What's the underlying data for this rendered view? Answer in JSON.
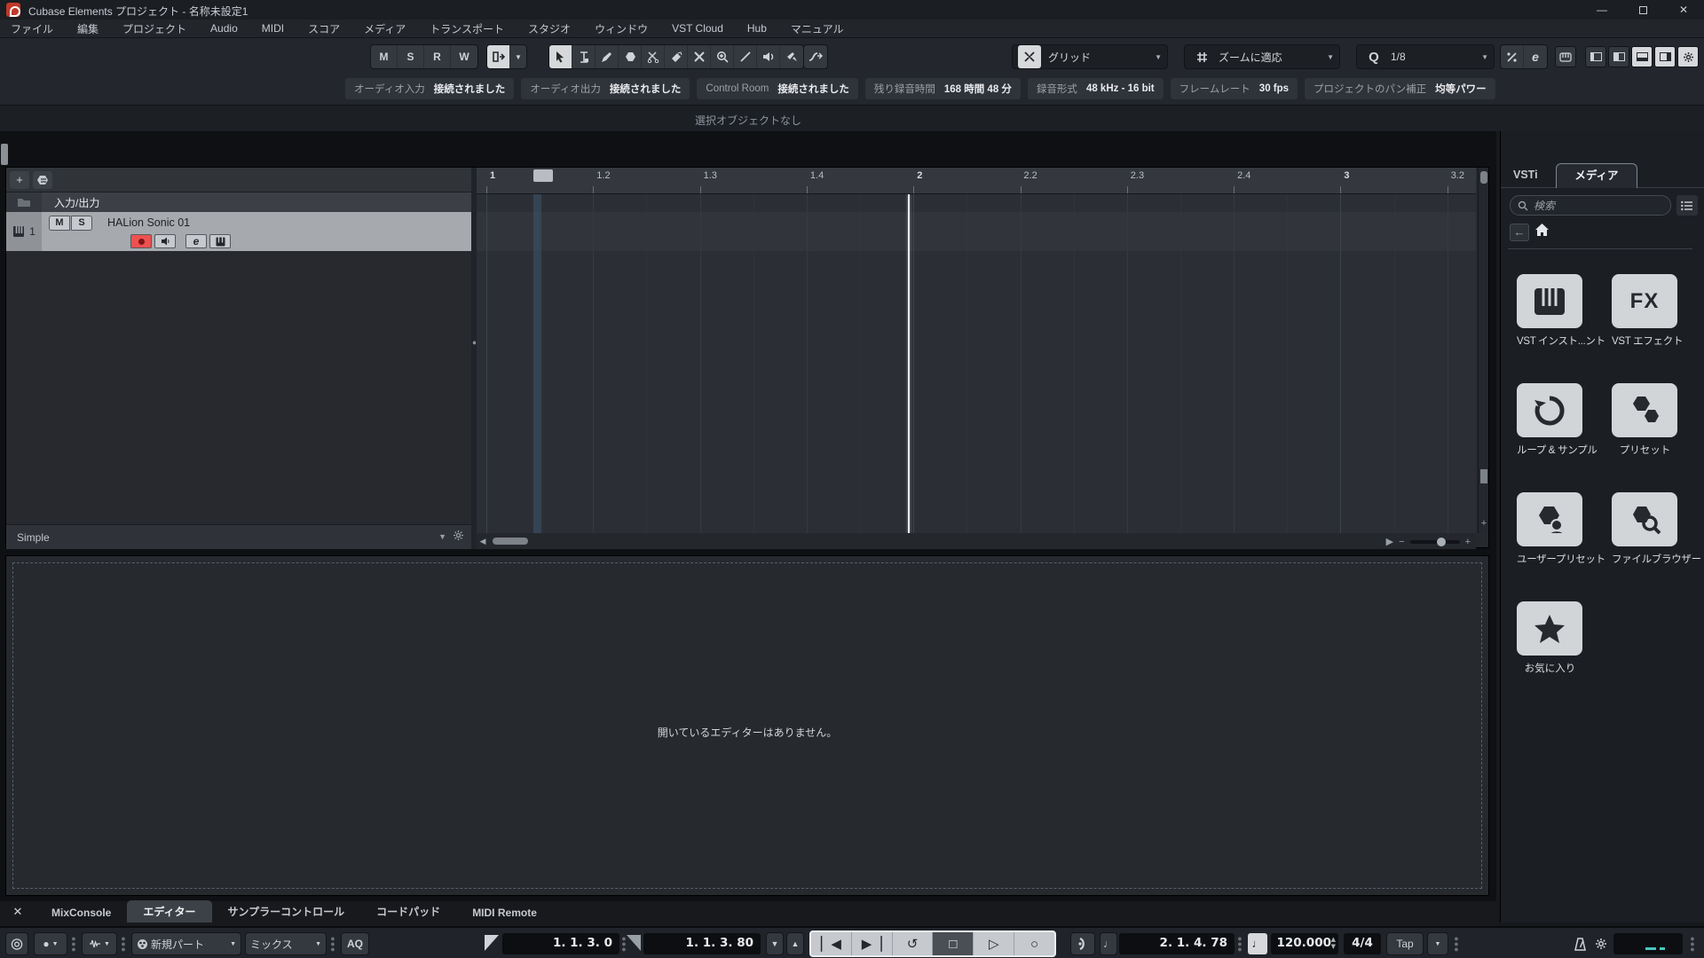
{
  "window": {
    "title": "Cubase Elements プロジェクト - 名称未設定1",
    "minimize": "—",
    "maximize": "",
    "close": "✕"
  },
  "menu": {
    "items": [
      "ファイル",
      "編集",
      "プロジェクト",
      "Audio",
      "MIDI",
      "スコア",
      "メディア",
      "トランスポート",
      "スタジオ",
      "ウィンドウ",
      "VST Cloud",
      "Hub",
      "マニュアル"
    ]
  },
  "toolbar": {
    "automation_buttons": [
      "M",
      "S",
      "R",
      "W"
    ],
    "grid_dropdown": "グリッド",
    "zoom_dropdown": "ズームに適応",
    "quantize_label": "Q",
    "quantize_value": "1/8",
    "quantize_e": "e"
  },
  "status_chips": [
    {
      "label": "オーディオ入力",
      "value": "接続されました"
    },
    {
      "label": "オーディオ出力",
      "value": "接続されました"
    },
    {
      "label": "Control Room",
      "value": "接続されました"
    },
    {
      "label": "残り録音時間",
      "value": "168 時間 48 分"
    },
    {
      "label": "録音形式",
      "value": "48 kHz - 16 bit"
    },
    {
      "label": "フレームレート",
      "value": "30 fps"
    },
    {
      "label": "プロジェクトのパン補正",
      "value": "均等パワー"
    }
  ],
  "info_line": {
    "selection": "選択オブジェクトなし"
  },
  "track_area": {
    "folder_label": "入力/出力",
    "track": {
      "number": "1",
      "name": "HALion Sonic 01",
      "mute": "M",
      "solo": "S",
      "edit": "e"
    },
    "footer": "Simple"
  },
  "ruler": {
    "ticks": [
      "1",
      "1.2",
      "1.3",
      "1.4",
      "2",
      "2.2",
      "2.3",
      "2.4",
      "3",
      "3.2"
    ]
  },
  "right_zone": {
    "tabs": {
      "vsti": "VSTi",
      "media": "メディア"
    },
    "search_placeholder": "検索",
    "tiles": [
      {
        "icon": "piano-icon",
        "label": "VST インスト...ント"
      },
      {
        "icon": "fx-icon",
        "label": "VST エフェクト"
      },
      {
        "icon": "loop-icon",
        "label": "ループ & サンプル"
      },
      {
        "icon": "presets-icon",
        "label": "プリセット"
      },
      {
        "icon": "user-presets-icon",
        "label": "ユーザープリセット"
      },
      {
        "icon": "file-browser-icon",
        "label": "ファイルブラウザー"
      },
      {
        "icon": "favorites-icon",
        "label": "お気に入り"
      }
    ]
  },
  "lower_zone": {
    "empty_text": "開いているエディターはありません。",
    "close": "✕",
    "tabs": [
      {
        "label": "MixConsole",
        "active": false
      },
      {
        "label": "エディター",
        "active": true
      },
      {
        "label": "サンプラーコントロール",
        "active": false
      },
      {
        "label": "コードパッド",
        "active": false
      },
      {
        "label": "MIDI Remote",
        "active": false
      }
    ]
  },
  "transport": {
    "record_part_mode": "新規パート",
    "cycle_record_mode": "ミックス",
    "aq": "AQ",
    "locator_left": "1. 1. 3.  0",
    "locator_right": "1. 1. 3. 80",
    "position": "2. 1. 4. 78",
    "tempo": "120.000",
    "time_signature": "4/4",
    "tap": "Tap"
  },
  "colors": {
    "record_red": "#ef5050",
    "selection_gray": "#a6a9ad",
    "midi_activity_cyan": "#49c7c2"
  }
}
